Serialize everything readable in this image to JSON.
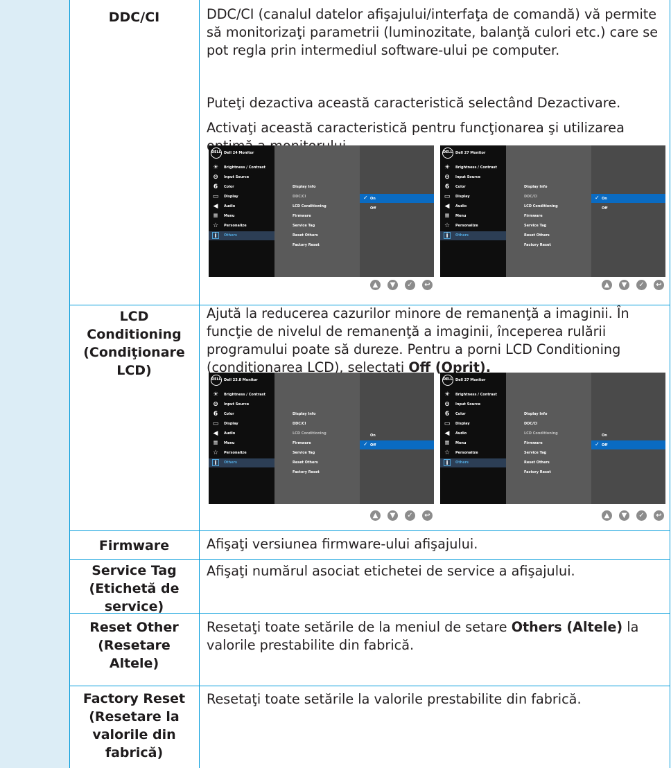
{
  "rows": [
    {
      "label": "DDC/CI",
      "paragraphs": [
        "DDC/CI (canalul datelor afişajului/interfaţa de comandă) vă permite să monitorizaţi parametrii (luminozitate, balanţă culori etc.) care se pot regla prin intermediul software-ului pe computer.",
        "Puteţi dezactiva această caracteristică selectând Dezactivare.",
        "Activaţi această caracteristică pentru funcţionarea şi utilizarea optimă a monitorului."
      ]
    },
    {
      "label": "LCD Conditioning (Condiţionare LCD)",
      "text_before": "Ajută la reducerea cazurilor minore de remanenţă a imaginii. În funcţie de nivelul de remanenţă a imaginii, începerea rulării programului poate să dureze. Pentru a porni LCD Conditioning (condiţionarea LCD), selectaţi ",
      "text_bold": "Off (Oprit)."
    },
    {
      "label": "Firmware",
      "text": "Afişaţi versiunea firmware-ului afişajului."
    },
    {
      "label": "Service Tag (Etichetă de service)",
      "text": "Afişaţi numărul asociat etichetei de service a afişajului."
    },
    {
      "label": "Reset Other (Resetare Altele)",
      "text_before": "Resetaţi toate setările de la meniul de setare ",
      "text_bold": "Others (Altele)",
      "text_after": " la valorile prestabilite din fabrică."
    },
    {
      "label": "Factory Reset (Resetare la valorile din fabrică)",
      "text": "Resetaţi toate setările la valorile prestabilite din fabrică."
    }
  ],
  "osd": {
    "logo": "DELL",
    "titles": [
      "Dell 24 Monitor",
      "Dell 27 Monitor",
      "Dell 23.8 Monitor",
      "Dell 27 Monitor"
    ],
    "nav": [
      {
        "icon": "brightness-icon",
        "glyph": "☀",
        "label": "Brightness / Contrast"
      },
      {
        "icon": "input-source-icon",
        "glyph": "⊖",
        "label": "Input Source"
      },
      {
        "icon": "color-icon",
        "glyph": "6",
        "label": "Color"
      },
      {
        "icon": "display-icon",
        "glyph": "▭",
        "label": "Display"
      },
      {
        "icon": "audio-icon",
        "glyph": "◀",
        "label": "Audio"
      },
      {
        "icon": "menu-icon",
        "glyph": "≡",
        "label": "Menu"
      },
      {
        "icon": "personalize-icon",
        "glyph": "☆",
        "label": "Personalize"
      },
      {
        "icon": "others-icon",
        "glyph": "i",
        "label": "Others"
      }
    ],
    "submenu": [
      "Display Info",
      "DDC/CI",
      "LCD Conditioning",
      "Firmware",
      "Service Tag",
      "Reset Others",
      "Factory Reset"
    ],
    "options": [
      "On",
      "Off"
    ],
    "check": "✓",
    "buttons": [
      {
        "icon": "up-icon",
        "glyph": "▲"
      },
      {
        "icon": "down-icon",
        "glyph": "▼"
      },
      {
        "icon": "check-icon",
        "glyph": "✓"
      },
      {
        "icon": "back-icon",
        "glyph": "↩"
      }
    ]
  },
  "colors": {
    "rule": "#009bdb",
    "band": "#dcedf6",
    "highlight": "#0a6bc2"
  }
}
